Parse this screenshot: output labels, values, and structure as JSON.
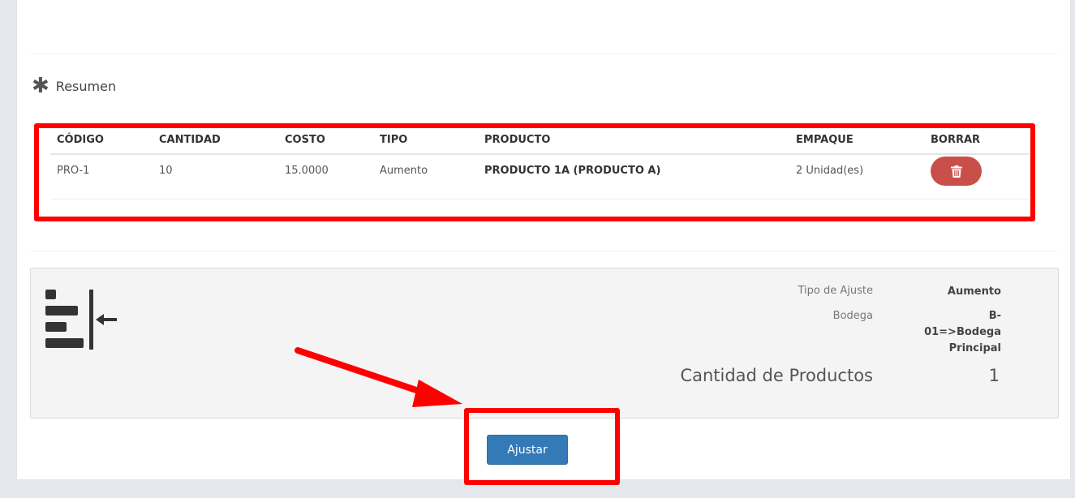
{
  "section": {
    "icon": "asterisk-icon",
    "title": "Resumen"
  },
  "table": {
    "headers": [
      "CÓDIGO",
      "CANTIDAD",
      "COSTO",
      "TIPO",
      "PRODUCTO",
      "EMPAQUE",
      "BORRAR"
    ],
    "rows": [
      {
        "codigo": "PRO-1",
        "cantidad": "10",
        "costo": "15.0000",
        "tipo": "Aumento",
        "producto": "PRODUCTO 1A (PRODUCTO A)",
        "empaque": "2 Unidad(es)",
        "borrar_icon": "trash-icon"
      }
    ]
  },
  "summary": {
    "icon": "align-left-indent-icon",
    "tipo_label": "Tipo de Ajuste",
    "tipo_value": "Aumento",
    "bodega_label": "Bodega",
    "bodega_value": "B-01=>Bodega Principal",
    "count_label": "Cantidad de Productos",
    "count_value": "1"
  },
  "actions": {
    "ajustar_label": "Ajustar"
  },
  "colors": {
    "primary": "#337ab7",
    "danger": "#c9504a",
    "highlight": "#ff0000"
  }
}
